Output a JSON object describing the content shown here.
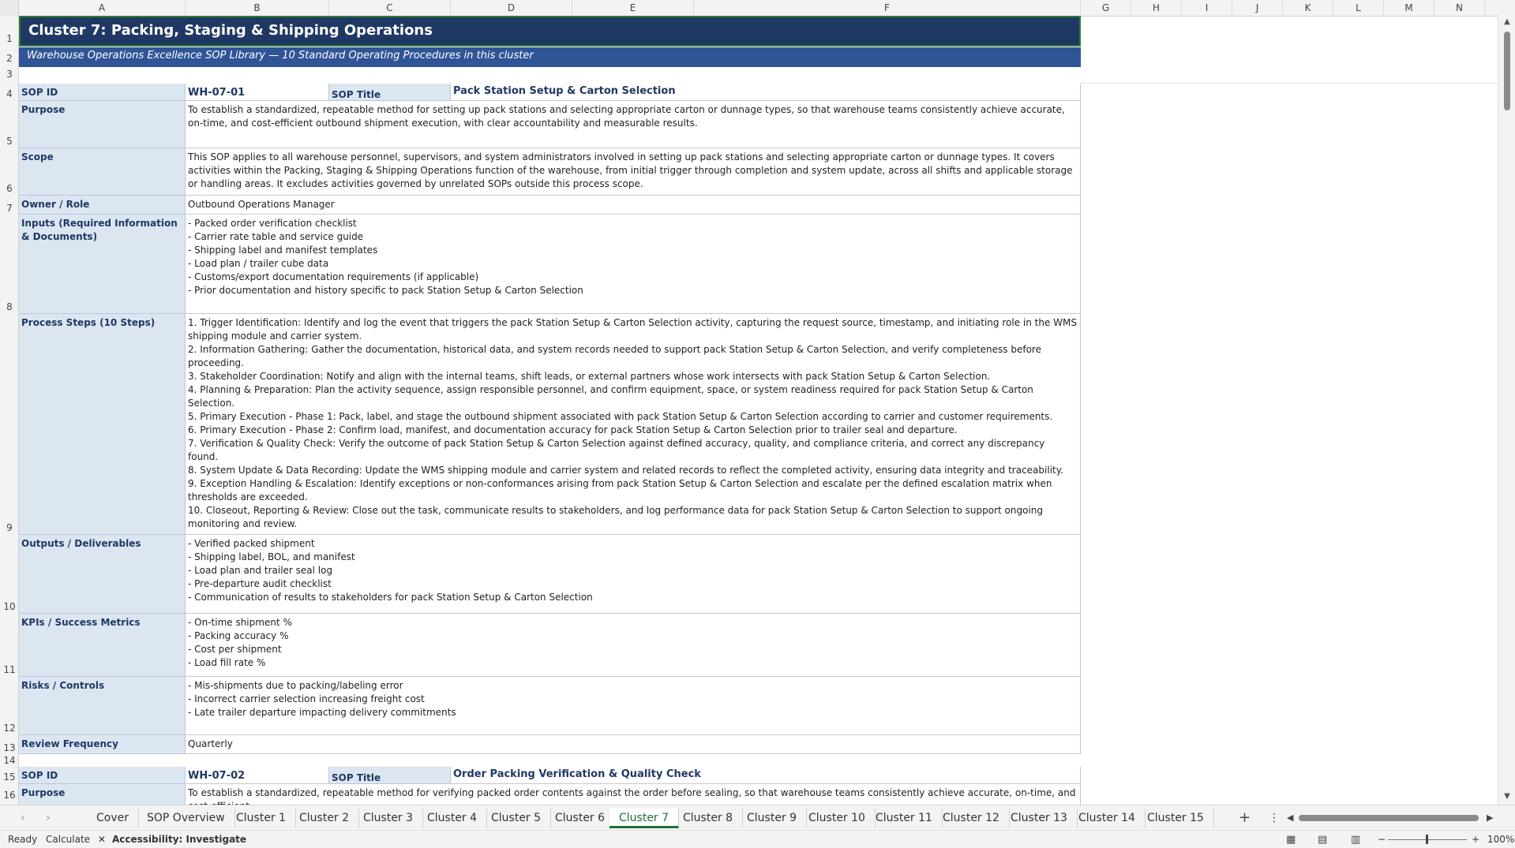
{
  "columns": [
    "A",
    "B",
    "C",
    "D",
    "E",
    "F",
    "G",
    "H",
    "I",
    "J",
    "K",
    "L",
    "M",
    "N"
  ],
  "rows": [
    "1",
    "2",
    "3",
    "4",
    "5",
    "6",
    "7",
    "8",
    "9",
    "10",
    "11",
    "12",
    "13",
    "14",
    "15",
    "16"
  ],
  "banner": {
    "title": "Cluster 7: Packing, Staging & Shipping Operations",
    "subtitle": "Warehouse Operations Excellence SOP Library — 10 Standard Operating Procedures in this cluster"
  },
  "sop1": {
    "id_label": "SOP ID",
    "id_value": "WH-07-01",
    "title_label": "SOP Title",
    "title_value": "Pack Station Setup & Carton Selection",
    "purpose_label": "Purpose",
    "purpose_value": "To establish a standardized, repeatable method for setting up pack stations and selecting appropriate carton or dunnage types, so that warehouse teams consistently achieve accurate, on-time, and cost-efficient outbound shipment execution, with clear accountability and measurable results.",
    "scope_label": "Scope",
    "scope_value": "This SOP applies to all warehouse personnel, supervisors, and system administrators involved in setting up pack stations and selecting appropriate carton or dunnage types. It covers activities within the Packing, Staging & Shipping Operations function of the warehouse, from initial trigger through completion and system update, across all shifts and applicable storage or handling areas. It excludes activities governed by unrelated SOPs outside this process scope.",
    "owner_label": "Owner / Role",
    "owner_value": "Outbound Operations Manager",
    "inputs_label": "Inputs (Required Information & Documents)",
    "inputs_value": "- Packed order verification checklist\n- Carrier rate table and service guide\n- Shipping label and manifest templates\n- Load plan / trailer cube data\n- Customs/export documentation requirements (if applicable)\n- Prior documentation and history specific to pack Station Setup & Carton Selection",
    "steps_label": "Process Steps (10 Steps)",
    "steps_value": "1. Trigger Identification: Identify and log the event that triggers the pack Station Setup & Carton Selection activity, capturing the request source, timestamp, and initiating role in the WMS shipping module and carrier system.\n2. Information Gathering: Gather the documentation, historical data, and system records needed to support pack Station Setup & Carton Selection, and verify completeness before proceeding.\n3. Stakeholder Coordination: Notify and align with the internal teams, shift leads, or external partners whose work intersects with pack Station Setup & Carton Selection.\n4. Planning & Preparation: Plan the activity sequence, assign responsible personnel, and confirm equipment, space, or system readiness required for pack Station Setup & Carton Selection.\n5. Primary Execution - Phase 1: Pack, label, and stage the outbound shipment associated with pack Station Setup & Carton Selection according to carrier and customer requirements.\n6. Primary Execution - Phase 2: Confirm load, manifest, and documentation accuracy for pack Station Setup & Carton Selection prior to trailer seal and departure.\n7. Verification & Quality Check: Verify the outcome of pack Station Setup & Carton Selection against defined accuracy, quality, and compliance criteria, and correct any discrepancy found.\n8. System Update & Data Recording: Update the WMS shipping module and carrier system and related records to reflect the completed activity, ensuring data integrity and traceability.\n9. Exception Handling & Escalation: Identify exceptions or non-conformances arising from pack Station Setup & Carton Selection and escalate per the defined escalation matrix when thresholds are exceeded.\n10. Closeout, Reporting & Review: Close out the task, communicate results to stakeholders, and log performance data for pack Station Setup & Carton Selection to support ongoing monitoring and review.",
    "outputs_label": "Outputs / Deliverables",
    "outputs_value": "- Verified packed shipment\n- Shipping label, BOL, and manifest\n- Load plan and trailer seal log\n- Pre-departure audit checklist\n- Communication of results to stakeholders for pack Station Setup & Carton Selection",
    "kpis_label": "KPIs / Success Metrics",
    "kpis_value": "- On-time shipment %\n- Packing accuracy %\n- Cost per shipment\n- Load fill rate %",
    "risks_label": "Risks / Controls",
    "risks_value": "- Mis-shipments due to packing/labeling error\n- Incorrect carrier selection increasing freight cost\n- Late trailer departure impacting delivery commitments",
    "review_label": "Review Frequency",
    "review_value": "Quarterly"
  },
  "sop2": {
    "id_label": "SOP ID",
    "id_value": "WH-07-02",
    "title_label": "SOP Title",
    "title_value": "Order Packing Verification & Quality Check",
    "purpose_label": "Purpose",
    "purpose_value": "To establish a standardized, repeatable method for verifying packed order contents against the order before sealing, so that warehouse teams consistently achieve accurate, on-time, and cost-efficient"
  },
  "tabs": [
    "Cover",
    "SOP Overview",
    "Cluster 1",
    "Cluster 2",
    "Cluster 3",
    "Cluster 4",
    "Cluster 5",
    "Cluster 6",
    "Cluster 7",
    "Cluster 8",
    "Cluster 9",
    "Cluster 10",
    "Cluster 11",
    "Cluster 12",
    "Cluster 13",
    "Cluster 14",
    "Cluster 15"
  ],
  "active_tab": "Cluster 7",
  "status": {
    "ready": "Ready",
    "calculate": "Calculate",
    "accessibility": "Accessibility: Investigate",
    "zoom": "100%"
  }
}
